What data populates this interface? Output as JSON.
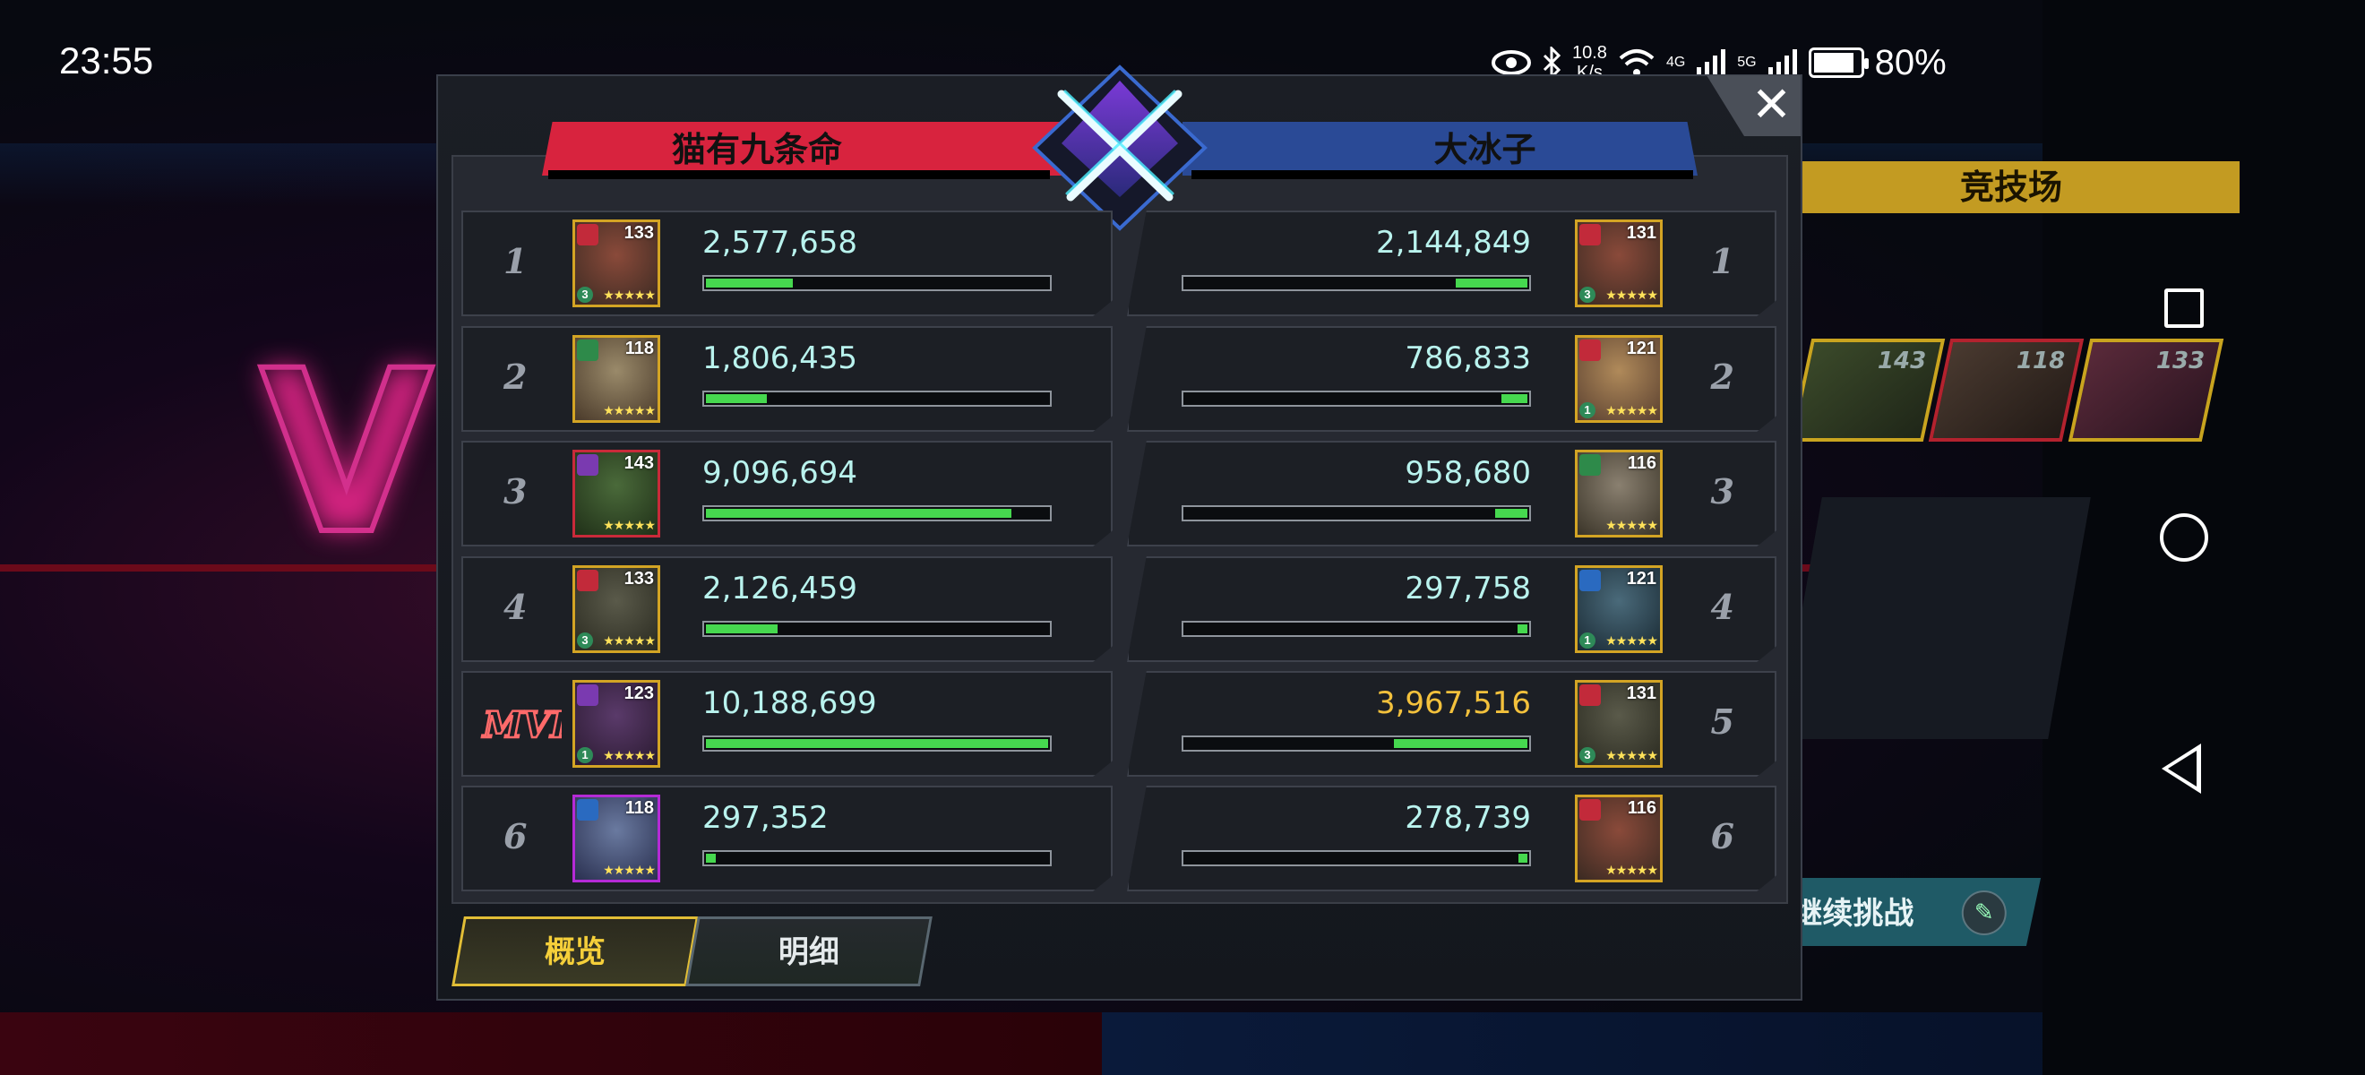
{
  "status_bar": {
    "time": "23:55",
    "speed_value": "10.8",
    "speed_unit": "K/s",
    "net_1": "4G",
    "net_2": "5G",
    "battery": "80%"
  },
  "background": {
    "arena_label": "竞技场",
    "team_levels": [
      "143",
      "118",
      "133"
    ],
    "continue_label": "继续挑战"
  },
  "battle": {
    "team_left": "猫有九条命",
    "team_right": "大冰子",
    "close_label": "✕",
    "left": [
      {
        "rank": "1",
        "level": "133",
        "tier": "3",
        "damage": "2,577,658",
        "fraction": 0.253,
        "frame": "#d3a424",
        "faction": "fire",
        "art": [
          "#8a4a3a",
          "#3a2a22"
        ]
      },
      {
        "rank": "2",
        "level": "118",
        "tier": "",
        "damage": "1,806,435",
        "fraction": 0.177,
        "frame": "#d3a424",
        "faction": "nature",
        "art": [
          "#9a8a6a",
          "#4a3a2a"
        ]
      },
      {
        "rank": "3",
        "level": "143",
        "tier": "",
        "damage": "9,096,694",
        "fraction": 0.893,
        "frame": "#c92a3a",
        "faction": "chaos",
        "art": [
          "#4a6a3a",
          "#203018"
        ]
      },
      {
        "rank": "4",
        "level": "133",
        "tier": "3",
        "damage": "2,126,459",
        "fraction": 0.209,
        "frame": "#d3a424",
        "faction": "fire",
        "art": [
          "#5a5a4a",
          "#2a2a20"
        ]
      },
      {
        "rank": "",
        "level": "123",
        "tier": "1",
        "damage": "10,188,699",
        "fraction": 1.0,
        "frame": "#d3a424",
        "faction": "chaos",
        "art": [
          "#5a3a6a",
          "#2a1a30"
        ],
        "mvp": true,
        "mvp_text": "MVP"
      },
      {
        "rank": "6",
        "level": "118",
        "tier": "",
        "damage": "297,352",
        "fraction": 0.029,
        "frame": "#b52ad6",
        "faction": "tech",
        "art": [
          "#6a7aa0",
          "#2a3050"
        ]
      }
    ],
    "right": [
      {
        "rank": "1",
        "level": "131",
        "tier": "3",
        "damage": "2,144,849",
        "fraction": 0.21,
        "frame": "#d3a424",
        "faction": "fire",
        "art": [
          "#8a4a3a",
          "#3a2a22"
        ],
        "gold": false
      },
      {
        "rank": "2",
        "level": "121",
        "tier": "1",
        "damage": "786,833",
        "fraction": 0.077,
        "frame": "#d3a424",
        "faction": "fire",
        "art": [
          "#b08a5a",
          "#5a4030"
        ],
        "gold": false
      },
      {
        "rank": "3",
        "level": "116",
        "tier": "",
        "damage": "958,680",
        "fraction": 0.094,
        "frame": "#d3a424",
        "faction": "nature",
        "art": [
          "#8a8070",
          "#3a3428"
        ],
        "gold": false
      },
      {
        "rank": "4",
        "level": "121",
        "tier": "1",
        "damage": "297,758",
        "fraction": 0.029,
        "frame": "#d3a424",
        "faction": "tech",
        "art": [
          "#4a6a7a",
          "#1a2a34"
        ],
        "gold": false
      },
      {
        "rank": "5",
        "level": "131",
        "tier": "3",
        "damage": "3,967,516",
        "fraction": 0.389,
        "frame": "#d3a424",
        "faction": "fire",
        "art": [
          "#5a5a4a",
          "#2a2a20"
        ],
        "gold": true
      },
      {
        "rank": "6",
        "level": "116",
        "tier": "",
        "damage": "278,739",
        "fraction": 0.027,
        "frame": "#d3a424",
        "faction": "fire",
        "art": [
          "#8a4a3a",
          "#3a2a22"
        ],
        "gold": false
      }
    ],
    "stars": "★★★★★",
    "tabs": {
      "overview": "概览",
      "detail": "明细"
    }
  }
}
